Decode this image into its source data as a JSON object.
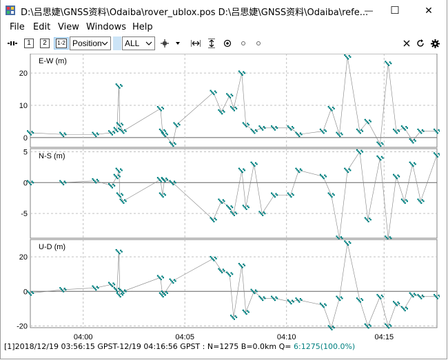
{
  "window": {
    "title": "D:\\吕思婕\\GNSS资料\\Odaiba\\rover_ublox.pos D:\\吕思婕\\GNSS资料\\Odaiba\\refe...",
    "minimize_glyph": "—",
    "maximize_glyph": "☐",
    "close_glyph": "✕"
  },
  "menu": [
    "File",
    "Edit",
    "View",
    "Windows",
    "Help"
  ],
  "toolbar": {
    "solution_1": "1",
    "solution_2": "2",
    "solution_12": "1-2",
    "plot_type": "Position",
    "quality": "ALL",
    "icons": [
      "connect-icon",
      "solution-1-icon",
      "solution-2-icon",
      "solution-diff-icon",
      "crosshair-icon",
      "fit-horizontal-icon",
      "fit-vertical-icon",
      "center-origin-icon",
      "show-track-icon",
      "show-point-icon",
      "clear-icon",
      "reload-icon",
      "settings-icon"
    ]
  },
  "status": {
    "text": "[1]2018/12/19 03:56:15 GPST-12/19 04:16:56 GPST : N=1275 B=0.0km Q= ",
    "quality_text": "6:1275(100.0%)",
    "quality_color": "#008080"
  },
  "chart_data": [
    {
      "type": "line",
      "title": "E-W (m)",
      "ylim": [
        -3,
        26
      ],
      "yticks": [
        0,
        10,
        20
      ],
      "x": [
        0.0,
        0.08,
        0.16,
        0.2,
        0.213,
        0.218,
        0.22,
        0.228,
        0.32,
        0.325,
        0.33,
        0.35,
        0.36,
        0.45,
        0.47,
        0.49,
        0.5,
        0.52,
        0.53,
        0.55,
        0.57,
        0.6,
        0.64,
        0.66,
        0.72,
        0.74,
        0.76,
        0.78,
        0.81,
        0.83,
        0.86,
        0.88,
        0.9,
        0.92,
        0.94,
        0.96,
        1.0
      ],
      "values": [
        1.5,
        1.0,
        1.0,
        1.5,
        2.5,
        16,
        4,
        2,
        9,
        2,
        1,
        -2,
        4,
        14,
        8,
        13,
        9,
        20,
        4,
        2,
        3,
        3,
        3,
        1,
        2,
        9,
        1,
        25,
        2,
        5,
        -2,
        23,
        2,
        3,
        -1,
        2,
        2
      ]
    },
    {
      "type": "line",
      "title": "N-S (m)",
      "ylim": [
        -9,
        5.5
      ],
      "yticks": [
        -5,
        0,
        5
      ],
      "x": [
        0.0,
        0.08,
        0.16,
        0.2,
        0.213,
        0.218,
        0.22,
        0.228,
        0.32,
        0.325,
        0.33,
        0.35,
        0.45,
        0.47,
        0.49,
        0.5,
        0.52,
        0.53,
        0.55,
        0.57,
        0.6,
        0.64,
        0.66,
        0.72,
        0.74,
        0.76,
        0.78,
        0.81,
        0.83,
        0.86,
        0.88,
        0.9,
        0.92,
        0.94,
        0.96,
        1.0
      ],
      "values": [
        0,
        0,
        0.3,
        -0.5,
        1,
        2,
        -2,
        -3,
        0.5,
        -2,
        0.5,
        0,
        -6,
        -3,
        -4,
        -5,
        2,
        -4,
        3,
        -5,
        -2,
        -2,
        2,
        1,
        -2,
        -9,
        2,
        5,
        -6,
        4,
        -9,
        1,
        -3,
        3,
        -3,
        4.5
      ]
    },
    {
      "type": "line",
      "title": "U-D (m)",
      "ylim": [
        -21,
        30
      ],
      "yticks": [
        -20,
        0,
        20
      ],
      "x": [
        0.0,
        0.08,
        0.16,
        0.2,
        0.213,
        0.218,
        0.22,
        0.228,
        0.32,
        0.325,
        0.33,
        0.35,
        0.45,
        0.47,
        0.49,
        0.5,
        0.52,
        0.53,
        0.55,
        0.57,
        0.6,
        0.64,
        0.66,
        0.72,
        0.74,
        0.76,
        0.78,
        0.81,
        0.83,
        0.86,
        0.88,
        0.9,
        0.92,
        0.94,
        0.96,
        1.0
      ],
      "values": [
        -1,
        1,
        2,
        4,
        1,
        23,
        -2,
        0,
        8,
        -2,
        -1,
        6,
        19,
        12,
        10,
        -15,
        15,
        -12,
        0,
        -4,
        -4,
        -6,
        -5,
        -8,
        -21,
        -4,
        28,
        -5,
        -20,
        -3,
        -20,
        -7,
        -10,
        -2,
        -3,
        -3
      ]
    }
  ],
  "x_axis": {
    "ticks": [
      "04:00",
      "04:05",
      "04:10",
      "04:15"
    ],
    "tick_positions": [
      0.13,
      0.38,
      0.63,
      0.87
    ]
  },
  "colors": {
    "series": "#008080",
    "grid": "#c0c0c0",
    "connector": "#808080"
  }
}
